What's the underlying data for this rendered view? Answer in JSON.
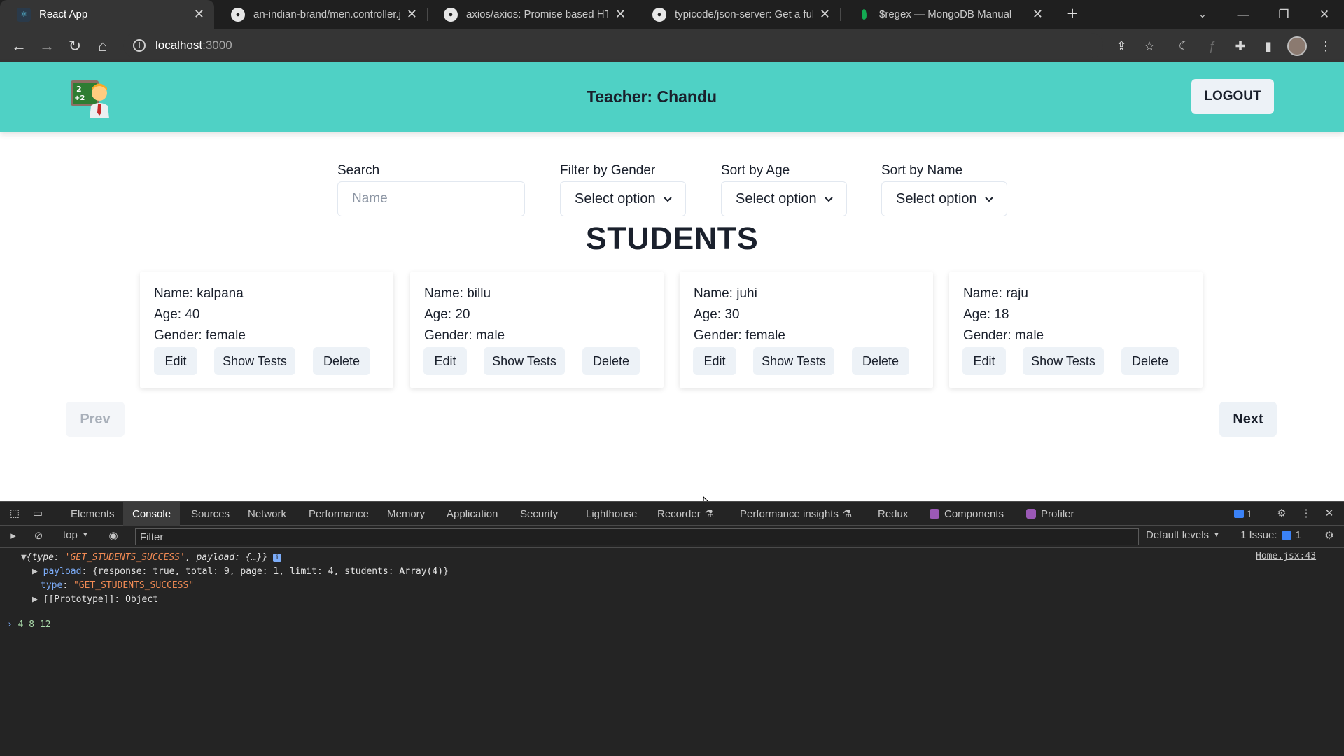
{
  "browser": {
    "tabs": [
      {
        "title": "React App",
        "icon": "react-icon"
      },
      {
        "title": "an-indian-brand/men.controller.j",
        "icon": "github-icon"
      },
      {
        "title": "axios/axios: Promise based HTTP",
        "icon": "github-icon"
      },
      {
        "title": "typicode/json-server: Get a full fa",
        "icon": "github-icon"
      },
      {
        "title": "$regex — MongoDB Manual",
        "icon": "mongodb-leaf-icon"
      }
    ],
    "url_host": "localhost",
    "url_port": ":3000"
  },
  "header": {
    "teacher_label": "Teacher: Chandu",
    "logout_label": "LOGOUT",
    "logo_icon": "teacher-chalkboard-icon"
  },
  "filters": {
    "search_label": "Search",
    "search_placeholder": "Name",
    "gender_label": "Filter by Gender",
    "gender_value": "Select option",
    "age_label": "Sort by Age",
    "age_value": "Select option",
    "name_label": "Sort by Name",
    "name_value": "Select option"
  },
  "heading": "STUDENTS",
  "students": [
    {
      "name": "Name: kalpana",
      "age": "Age: 40",
      "gender": "Gender: female"
    },
    {
      "name": "Name: billu",
      "age": "Age: 20",
      "gender": "Gender: male"
    },
    {
      "name": "Name: juhi",
      "age": "Age: 30",
      "gender": "Gender: female"
    },
    {
      "name": "Name: raju",
      "age": "Age: 18",
      "gender": "Gender: male"
    }
  ],
  "card_actions": {
    "edit": "Edit",
    "tests": "Show Tests",
    "delete": "Delete"
  },
  "pagination": {
    "prev": "Prev",
    "next": "Next"
  },
  "devtools": {
    "tabs": [
      "Elements",
      "Console",
      "Sources",
      "Network",
      "Performance",
      "Memory",
      "Application",
      "Security",
      "Lighthouse",
      "Recorder",
      "Performance insights",
      "Redux",
      "Components",
      "Profiler"
    ],
    "active_tab": "Console",
    "message_count": "1",
    "context": "top",
    "filter_placeholder": "Filter",
    "levels": "Default levels",
    "issues": "1 Issue:",
    "issues_count": "1",
    "source_link": "Home.jsx:43",
    "log": {
      "summary_type_value": "'GET_STUDENTS_SUCCESS'",
      "payload_line": "{response: true, total: 9, page: 1, limit: 4, students: Array(4)}",
      "type_value": "\"GET_STUDENTS_SUCCESS\"",
      "prototype_value": "Object",
      "output": "4 8 12"
    }
  }
}
